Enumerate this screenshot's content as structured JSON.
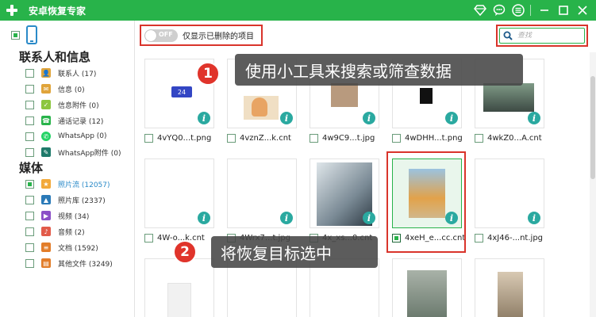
{
  "app": {
    "title": "安卓恢复专家"
  },
  "sidebar": {
    "sections": [
      {
        "title": "联系人和信息",
        "items": [
          {
            "label": "联系人 (17)",
            "icon": "contacts-icon",
            "color": "#e0a43a"
          },
          {
            "label": "信息 (0)",
            "icon": "message-icon",
            "color": "#e0a43a"
          },
          {
            "label": "信息附件 (0)",
            "icon": "message-attachment-icon",
            "color": "#8cc63f"
          },
          {
            "label": "通话记录 (12)",
            "icon": "call-log-icon",
            "color": "#28b34a"
          },
          {
            "label": "WhatsApp (0)",
            "icon": "whatsapp-icon",
            "color": "#25d366"
          },
          {
            "label": "WhatsApp附件 (0)",
            "icon": "whatsapp-attachment-icon",
            "color": "#1f7a6a"
          }
        ]
      },
      {
        "title": "媒体",
        "items": [
          {
            "label": "照片流 (12057)",
            "icon": "photo-stream-icon",
            "color": "#f2a93b",
            "active": true
          },
          {
            "label": "照片库 (2337)",
            "icon": "photo-library-icon",
            "color": "#2a7ab8"
          },
          {
            "label": "视频 (34)",
            "icon": "video-icon",
            "color": "#8a4fc7"
          },
          {
            "label": "音频 (2)",
            "icon": "audio-icon",
            "color": "#e25b4a"
          },
          {
            "label": "文档 (1592)",
            "icon": "document-icon",
            "color": "#e27d2a"
          },
          {
            "label": "其他文件 (3249)",
            "icon": "other-files-icon",
            "color": "#e27d2a"
          }
        ]
      }
    ]
  },
  "toolbar": {
    "toggle_label": "OFF",
    "filter_label": "仅显示已删除的项目",
    "search_placeholder": "查找"
  },
  "grid": {
    "row1": [
      "4vYQ0...t.png",
      "4vznZ...k.cnt",
      "4w9C9...t.jpg",
      "4wDHH...t.png",
      "4wkZ0...A.cnt"
    ],
    "row2": [
      "4W-o...k.cnt",
      "4Wrx7...t.jpg",
      "4x_xs...0.cnt",
      "4xeH_e...cc.cnt",
      "4xJ46-...nt.jpg"
    ],
    "selected_index": 3,
    "thumb_badge": "24"
  },
  "callouts": {
    "c1_number": "1",
    "c1_text": "使用小工具来搜索或筛查数据",
    "c2_number": "2",
    "c2_text": "将恢复目标选中"
  },
  "colors": {
    "accent": "#28b34a",
    "highlight": "#d9342b",
    "info": "#2aa9a0"
  }
}
